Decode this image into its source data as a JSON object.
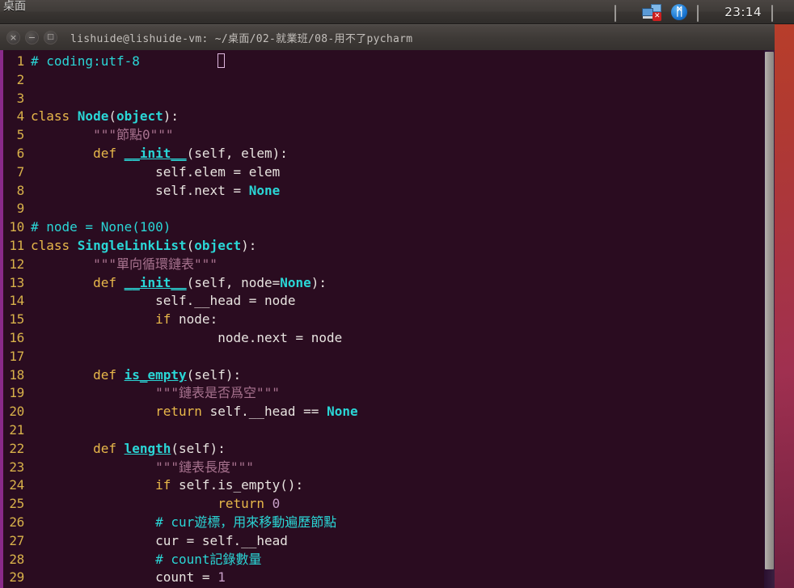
{
  "panel": {
    "app_name": "桌面",
    "clock": "23:14",
    "tray": [
      {
        "name": "keyboard-indicator-icon",
        "kind": "rect"
      },
      {
        "name": "network-disconnected-icon",
        "kind": "network",
        "badge": "✕"
      },
      {
        "name": "bluetooth-icon",
        "kind": "bluetooth",
        "glyph": "ᛗ"
      },
      {
        "name": "sound-indicator-icon",
        "kind": "rect"
      }
    ],
    "tray_end": {
      "name": "session-menu-icon",
      "kind": "rect"
    }
  },
  "window": {
    "title": "lishuide@lishuide-vm: ~/桌面/02-就業班/08-用不了pycharm",
    "buttons": {
      "close": "×",
      "minimize": "−",
      "maximize": "□"
    }
  },
  "editor": {
    "cursor_line": 1,
    "cursor_column": 24,
    "lines": [
      {
        "n": "1",
        "tokens": [
          {
            "t": "# coding:utf-8",
            "c": "tk-comment"
          },
          {
            "t": "          ",
            "c": "tk-plain"
          },
          {
            "t": "CURSOR",
            "c": "cursor"
          }
        ]
      },
      {
        "n": "2",
        "tokens": []
      },
      {
        "n": "3",
        "tokens": []
      },
      {
        "n": "4",
        "tokens": [
          {
            "t": "class ",
            "c": "tk-keyword"
          },
          {
            "t": "Node",
            "c": "tk-classname"
          },
          {
            "t": "(",
            "c": "tk-plain"
          },
          {
            "t": "object",
            "c": "tk-builtin"
          },
          {
            "t": "):",
            "c": "tk-plain"
          }
        ]
      },
      {
        "n": "5",
        "tokens": [
          {
            "t": "        ",
            "c": "tk-plain"
          },
          {
            "t": "\"\"\"節點0\"\"\"",
            "c": "tk-doc"
          }
        ]
      },
      {
        "n": "6",
        "tokens": [
          {
            "t": "        ",
            "c": "tk-plain"
          },
          {
            "t": "def ",
            "c": "tk-keyword"
          },
          {
            "t": "__init__",
            "c": "tk-func"
          },
          {
            "t": "(self, elem):",
            "c": "tk-plain"
          }
        ]
      },
      {
        "n": "7",
        "tokens": [
          {
            "t": "                ",
            "c": "tk-plain"
          },
          {
            "t": "self.elem = elem",
            "c": "tk-plain"
          }
        ]
      },
      {
        "n": "8",
        "tokens": [
          {
            "t": "                ",
            "c": "tk-plain"
          },
          {
            "t": "self.next = ",
            "c": "tk-plain"
          },
          {
            "t": "None",
            "c": "tk-none"
          }
        ]
      },
      {
        "n": "9",
        "tokens": []
      },
      {
        "n": "10",
        "tokens": [
          {
            "t": "# node = None(100)",
            "c": "tk-comment"
          }
        ]
      },
      {
        "n": "11",
        "tokens": [
          {
            "t": "class ",
            "c": "tk-keyword"
          },
          {
            "t": "SingleLinkList",
            "c": "tk-classname"
          },
          {
            "t": "(",
            "c": "tk-plain"
          },
          {
            "t": "object",
            "c": "tk-builtin"
          },
          {
            "t": "):",
            "c": "tk-plain"
          }
        ]
      },
      {
        "n": "12",
        "tokens": [
          {
            "t": "        ",
            "c": "tk-plain"
          },
          {
            "t": "\"\"\"單向循環鏈表\"\"\"",
            "c": "tk-doc"
          }
        ]
      },
      {
        "n": "13",
        "tokens": [
          {
            "t": "        ",
            "c": "tk-plain"
          },
          {
            "t": "def ",
            "c": "tk-keyword"
          },
          {
            "t": "__init__",
            "c": "tk-func"
          },
          {
            "t": "(self, node=",
            "c": "tk-plain"
          },
          {
            "t": "None",
            "c": "tk-none"
          },
          {
            "t": "):",
            "c": "tk-plain"
          }
        ]
      },
      {
        "n": "14",
        "tokens": [
          {
            "t": "                ",
            "c": "tk-plain"
          },
          {
            "t": "self.__head = node",
            "c": "tk-plain"
          }
        ]
      },
      {
        "n": "15",
        "tokens": [
          {
            "t": "                ",
            "c": "tk-plain"
          },
          {
            "t": "if ",
            "c": "tk-keyword"
          },
          {
            "t": "node:",
            "c": "tk-plain"
          }
        ]
      },
      {
        "n": "16",
        "tokens": [
          {
            "t": "                        ",
            "c": "tk-plain"
          },
          {
            "t": "node.next = node",
            "c": "tk-plain"
          }
        ]
      },
      {
        "n": "17",
        "tokens": []
      },
      {
        "n": "18",
        "tokens": [
          {
            "t": "        ",
            "c": "tk-plain"
          },
          {
            "t": "def ",
            "c": "tk-keyword"
          },
          {
            "t": "is_empty",
            "c": "tk-func"
          },
          {
            "t": "(self):",
            "c": "tk-plain"
          }
        ]
      },
      {
        "n": "19",
        "tokens": [
          {
            "t": "                ",
            "c": "tk-plain"
          },
          {
            "t": "\"\"\"鏈表是否爲空\"\"\"",
            "c": "tk-doc"
          }
        ]
      },
      {
        "n": "20",
        "tokens": [
          {
            "t": "                ",
            "c": "tk-plain"
          },
          {
            "t": "return ",
            "c": "tk-keyword"
          },
          {
            "t": "self.__head == ",
            "c": "tk-plain"
          },
          {
            "t": "None",
            "c": "tk-none"
          }
        ]
      },
      {
        "n": "21",
        "tokens": []
      },
      {
        "n": "22",
        "tokens": [
          {
            "t": "        ",
            "c": "tk-plain"
          },
          {
            "t": "def ",
            "c": "tk-keyword"
          },
          {
            "t": "length",
            "c": "tk-func"
          },
          {
            "t": "(self):",
            "c": "tk-plain"
          }
        ]
      },
      {
        "n": "23",
        "tokens": [
          {
            "t": "                ",
            "c": "tk-plain"
          },
          {
            "t": "\"\"\"鏈表長度\"\"\"",
            "c": "tk-doc"
          }
        ]
      },
      {
        "n": "24",
        "tokens": [
          {
            "t": "                ",
            "c": "tk-plain"
          },
          {
            "t": "if ",
            "c": "tk-keyword"
          },
          {
            "t": "self.is_empty():",
            "c": "tk-plain"
          }
        ]
      },
      {
        "n": "25",
        "tokens": [
          {
            "t": "                        ",
            "c": "tk-plain"
          },
          {
            "t": "return ",
            "c": "tk-keyword"
          },
          {
            "t": "0",
            "c": "tk-num"
          }
        ]
      },
      {
        "n": "26",
        "tokens": [
          {
            "t": "                ",
            "c": "tk-plain"
          },
          {
            "t": "# cur遊標，用來移動遍歷節點",
            "c": "tk-comment"
          }
        ]
      },
      {
        "n": "27",
        "tokens": [
          {
            "t": "                ",
            "c": "tk-plain"
          },
          {
            "t": "cur = self.__head",
            "c": "tk-plain"
          }
        ]
      },
      {
        "n": "28",
        "tokens": [
          {
            "t": "                ",
            "c": "tk-plain"
          },
          {
            "t": "# count記錄數量",
            "c": "tk-comment"
          }
        ]
      },
      {
        "n": "29",
        "tokens": [
          {
            "t": "                ",
            "c": "tk-plain"
          },
          {
            "t": "count = ",
            "c": "tk-plain"
          },
          {
            "t": "1",
            "c": "tk-num"
          }
        ]
      }
    ]
  },
  "colors": {
    "terminal_bg": "#2a0c20",
    "panel_bg": "#3f3b38",
    "accent_magenta": "#8a2a8a",
    "comment": "#2ad6d6",
    "keyword": "#e8b84a",
    "lineno": "#d8b14a",
    "docstring": "#a8738f",
    "wallpaper": "#c3441f"
  }
}
